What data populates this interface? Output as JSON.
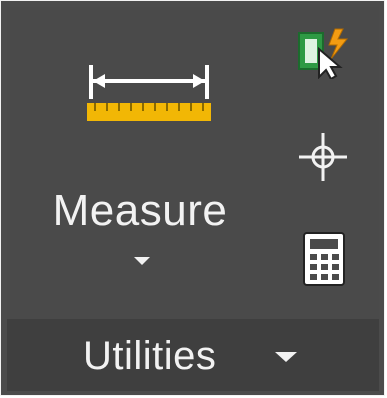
{
  "panel": {
    "measure_button": {
      "label": "Measure",
      "icon": "measure-icon",
      "has_dropdown": true
    },
    "side_tools": [
      {
        "id": "quick-select",
        "icon": "quick-select-icon"
      },
      {
        "id": "id-point",
        "icon": "crosshair-icon"
      },
      {
        "id": "calculator",
        "icon": "calculator-icon"
      }
    ],
    "footer": {
      "title": "Utilities",
      "has_dropdown": true
    }
  },
  "colors": {
    "background": "#4a4a4a",
    "footer_background": "#3f3f3f",
    "text": "#f2f2f2",
    "ruler": "#f2b705",
    "quick_select_green": "#2e9a44",
    "quick_select_orange": "#f39c12"
  }
}
